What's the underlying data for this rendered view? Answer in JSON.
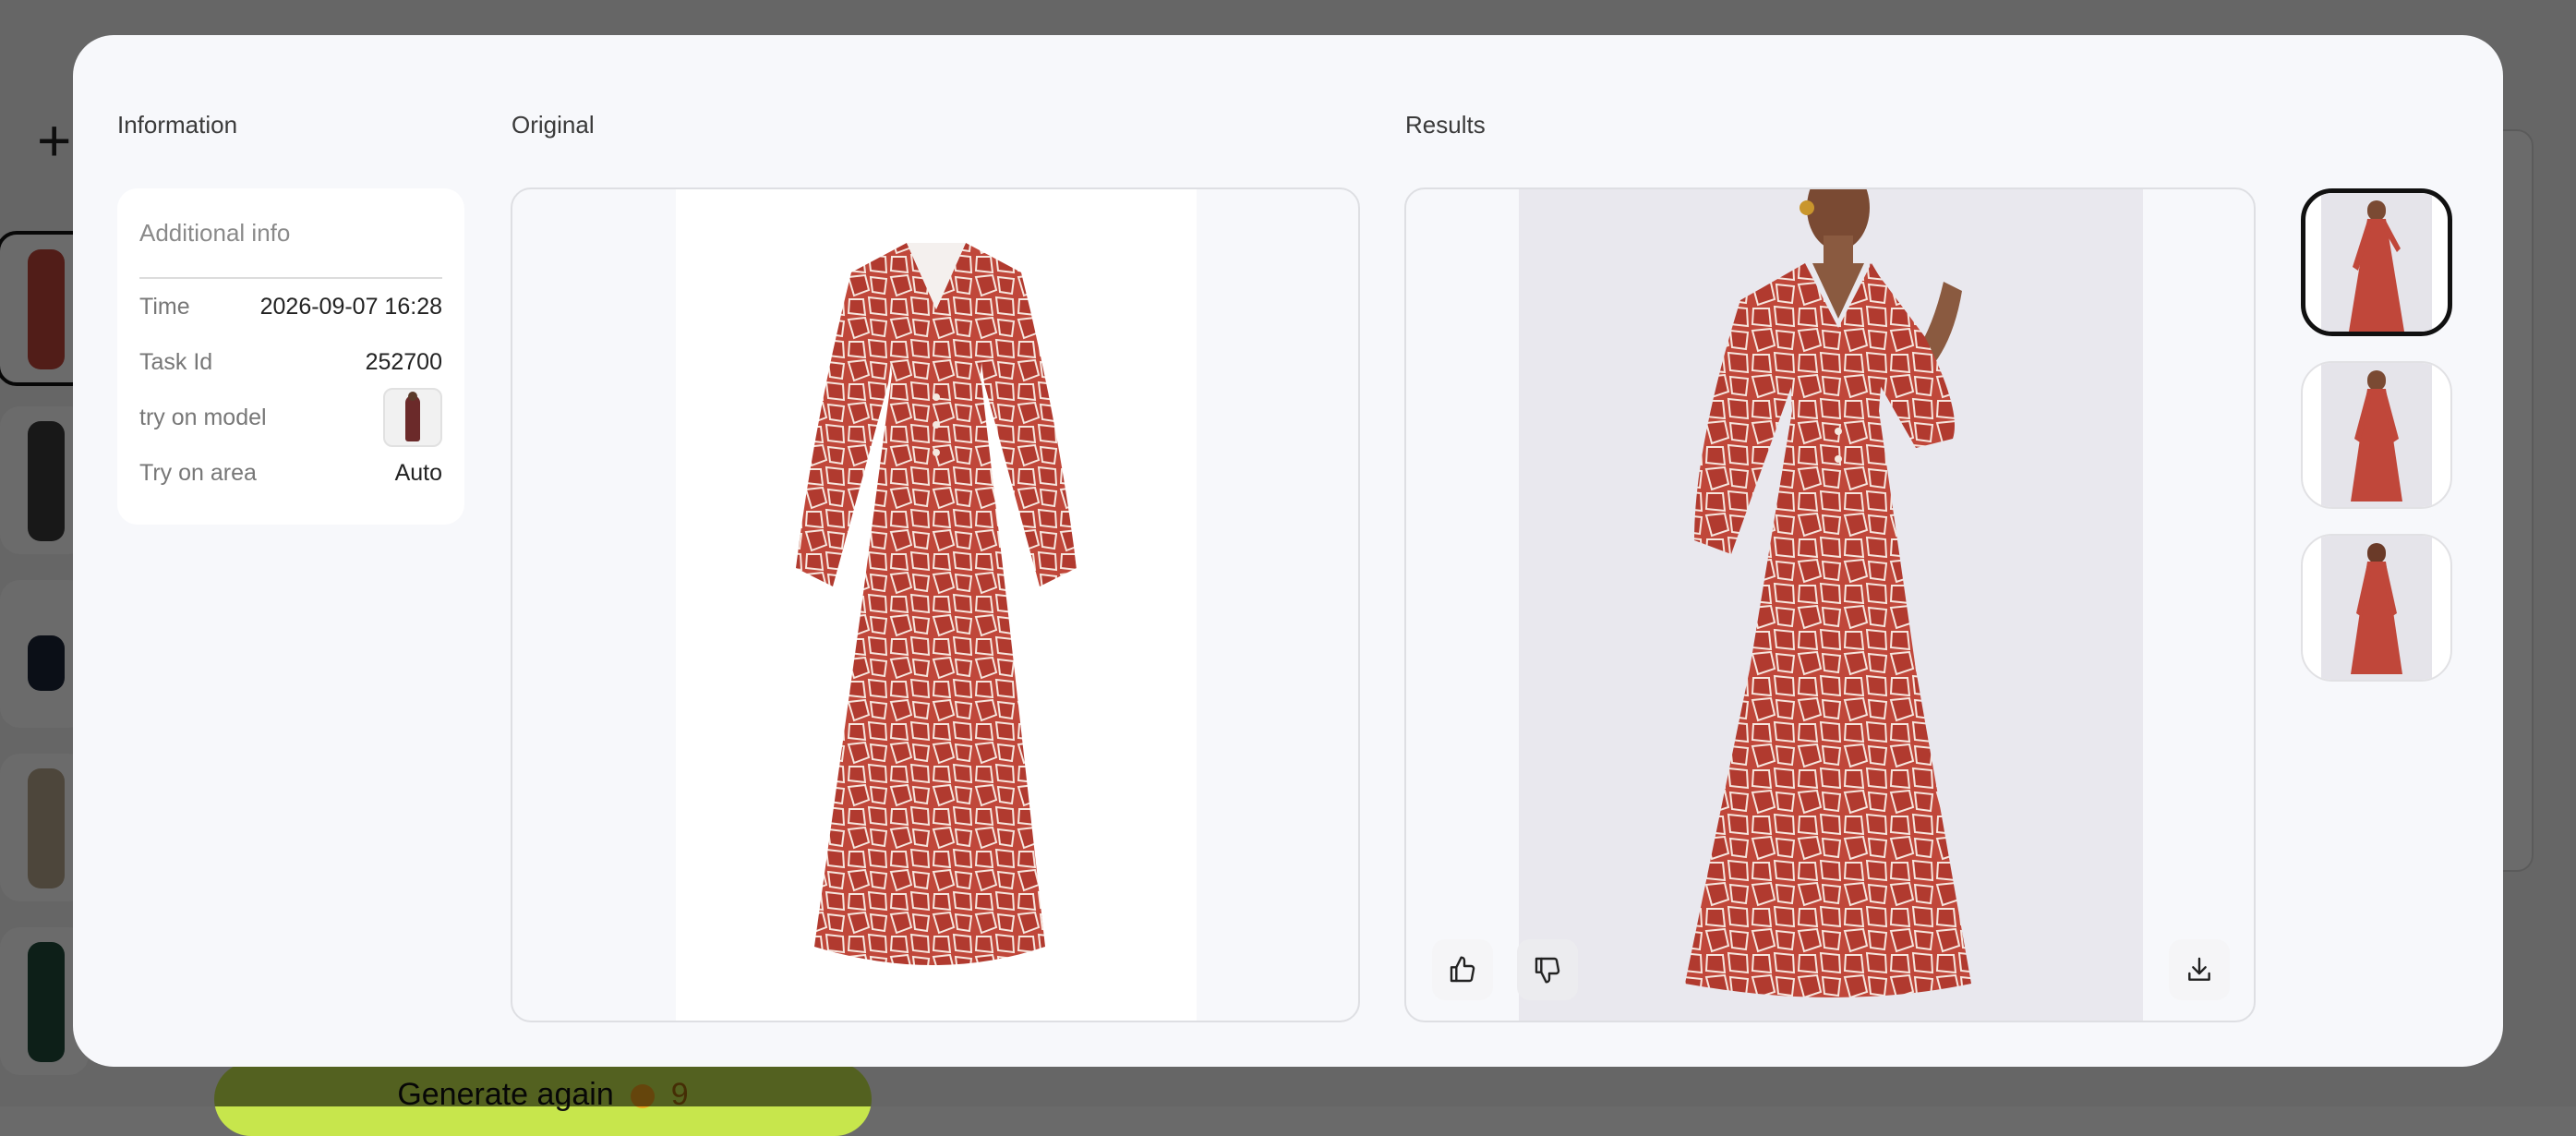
{
  "modal": {
    "info_title": "Information",
    "original_title": "Original",
    "results_title": "Results"
  },
  "info": {
    "header": "Additional info",
    "rows": [
      {
        "label": "Time",
        "value": "2026-09-07 16:28"
      },
      {
        "label": "Task Id",
        "value": "252700"
      },
      {
        "label": "try on model",
        "value": ""
      },
      {
        "label": "Try on area",
        "value": "Auto"
      }
    ]
  },
  "background": {
    "generate_label": "Generate again",
    "generate_cost": "9"
  },
  "colors": {
    "dress_red": "#c0473a",
    "accent_green": "#c7e64c",
    "selected_border": "#111111"
  },
  "icons": [
    "thumbs-up-icon",
    "thumbs-down-icon",
    "download-icon",
    "plus-icon"
  ],
  "results": {
    "thumbnail_count": 3,
    "selected_index": 0
  }
}
